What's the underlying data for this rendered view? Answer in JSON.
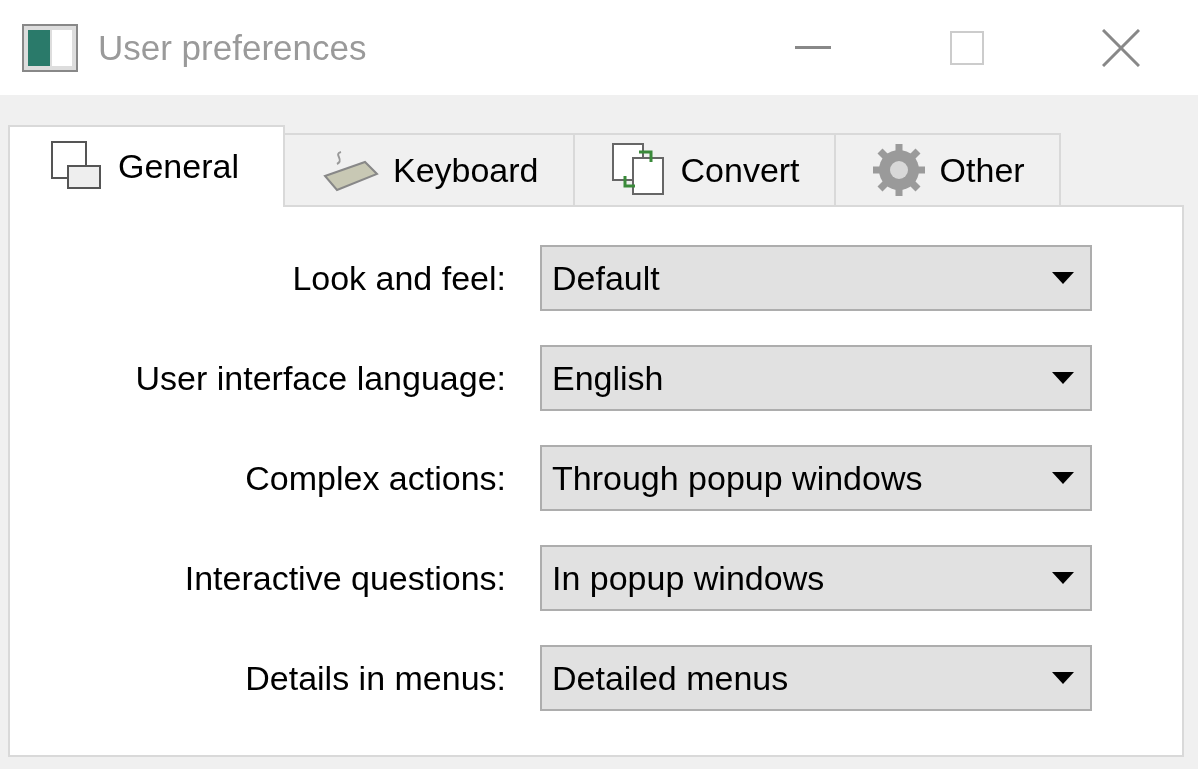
{
  "window": {
    "title": "User preferences"
  },
  "tabs": [
    {
      "label": "General",
      "selected": true
    },
    {
      "label": "Keyboard",
      "selected": false
    },
    {
      "label": "Convert",
      "selected": false
    },
    {
      "label": "Other",
      "selected": false
    }
  ],
  "fields": [
    {
      "label": "Look and feel:",
      "value": "Default"
    },
    {
      "label": "User interface language:",
      "value": "English"
    },
    {
      "label": "Complex actions:",
      "value": "Through popup windows"
    },
    {
      "label": "Interactive questions:",
      "value": "In popup windows"
    },
    {
      "label": "Details in menus:",
      "value": "Detailed menus"
    }
  ]
}
